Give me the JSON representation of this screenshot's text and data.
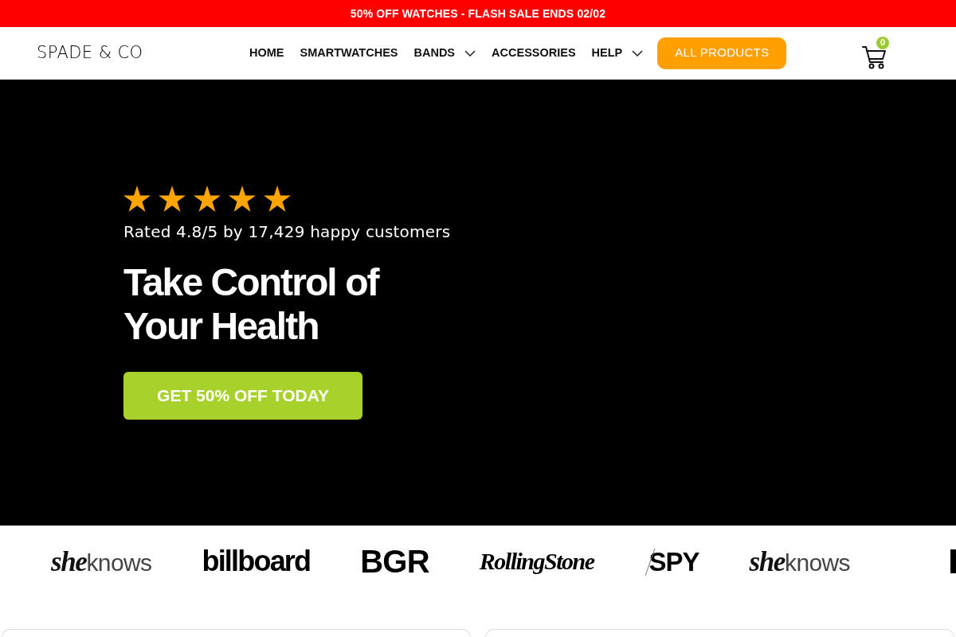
{
  "announcement_bar": {
    "text": "50% OFF WATCHES - FLASH SALE ENDS 02/02"
  },
  "header": {
    "logo": "SPADE & CO",
    "nav": [
      {
        "label": "HOME",
        "dropdown": false
      },
      {
        "label": "SMARTWATCHES",
        "dropdown": false
      },
      {
        "label": "BANDS",
        "dropdown": true
      },
      {
        "label": "ACCESSORIES",
        "dropdown": false
      },
      {
        "label": "HELP",
        "dropdown": true
      }
    ],
    "cta_button": "ALL PRODUCTS",
    "cart": {
      "count": "0"
    }
  },
  "hero": {
    "rating": {
      "stars": 5,
      "text": "Rated 4.8/5 by 17,429 happy customers"
    },
    "heading": "Take Control of Your Health",
    "button": "GET 50% OFF TODAY"
  },
  "press_logos": [
    {
      "kind": "script",
      "lead": "she",
      "text": "knows"
    },
    {
      "kind": "heavy",
      "text": "billboard"
    },
    {
      "kind": "stencil",
      "text": "BGR"
    },
    {
      "kind": "serif",
      "text": "RollingStone"
    },
    {
      "kind": "slashed",
      "text": "SPY"
    },
    {
      "kind": "script",
      "lead": "she",
      "text": "knows"
    }
  ]
}
